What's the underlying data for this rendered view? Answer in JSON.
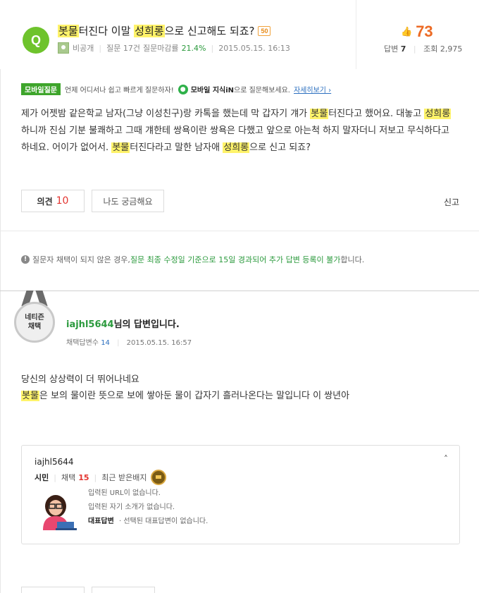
{
  "question": {
    "badge": "Q",
    "title_parts": [
      {
        "text": "봇물",
        "hl": true
      },
      {
        "text": "터진다 이말 ",
        "hl": false
      },
      {
        "text": "성희롱",
        "hl": true
      },
      {
        "text": "으로 신고해도 되죠?",
        "hl": false
      }
    ],
    "points": "50",
    "author": "비공개",
    "meta_question": "질문 17건",
    "meta_close_label": "질문마감률",
    "meta_close_rate": "21.4%",
    "date": "2015.05.15. 16:13",
    "likes": "73",
    "answers_label": "답변",
    "answers_count": "7",
    "views_label": "조회",
    "views_count": "2,975",
    "body_parts": [
      {
        "text": "제가 어젯밤 같은학교 남자(그냥 이성친구)랑 카톡을 했는데 막 갑자기 걔가 ",
        "hl": false
      },
      {
        "text": "봇물",
        "hl": true
      },
      {
        "text": "터진다고 했어요. 대놓고 ",
        "hl": false
      },
      {
        "text": "성희롱",
        "hl": true
      },
      {
        "text": "하니까 진심 기분 불쾌하고 그때 걔한테 쌍욕이란 쌍욕은 다했고 앞으로 아는척 하지 말자더니 저보고 무식하다고 하네요. 어이가 없어서. ",
        "hl": false
      },
      {
        "text": "봇물",
        "hl": true
      },
      {
        "text": "터진다라고 말한 남자애 ",
        "hl": false
      },
      {
        "text": "성희롱",
        "hl": true
      },
      {
        "text": "으로 신고 되죠?",
        "hl": false
      }
    ]
  },
  "mobile": {
    "tag": "모바일질문",
    "text": "언제 어디서나 쉽고 빠르게 질문하자!",
    "kin_label": "모바일 지식iN",
    "kin_text": "으로 질문해보세요.",
    "detail": "자세히보기 ›"
  },
  "actions": {
    "opinion_label": "의견",
    "opinion_count": "10",
    "curious_label": "나도 궁금해요",
    "report_label": "신고"
  },
  "notice": {
    "prefix": "질문자 채택이 되지 않은 경우, ",
    "emph": "질문 최종 수정일 기준으로 15일 경과되어 추가 답변 등록이 불가",
    "suffix": "합니다."
  },
  "answer": {
    "medal_line1": "네티즌",
    "medal_line2": "채택",
    "user_id": "iajhl5644",
    "title_suffix": "님의 답변입니다.",
    "adopt_label": "채택답변수",
    "adopt_count": "14",
    "date": "2015.05.15. 16:57",
    "line1": "당신의 상상력이 더 뛰어나네요",
    "line2_parts": [
      {
        "text": "봇물",
        "hl": true
      },
      {
        "text": "은 보의 물이란 뜻으로 보에 쌓아둔 물이 갑자기 흘러나온다는 말입니다 이 쌍년아",
        "hl": false
      }
    ]
  },
  "profile": {
    "user_id": "iajhl5644",
    "rank": "시민",
    "adopt_label": "채택",
    "adopt_count": "15",
    "badge_label": "최근 받은배지",
    "url_text": "입력된 URL이 없습니다.",
    "intro_text": "입력된 자기 소개가 없습니다.",
    "rep_label": "대표답변",
    "rep_text": "· 선택된 대표답변이 없습니다.",
    "chevron": "˄"
  },
  "colors": {
    "accent_green": "#6ec32c",
    "like_orange": "#ec6a24",
    "highlight": "#fff36a",
    "count_red": "#e3342f"
  }
}
